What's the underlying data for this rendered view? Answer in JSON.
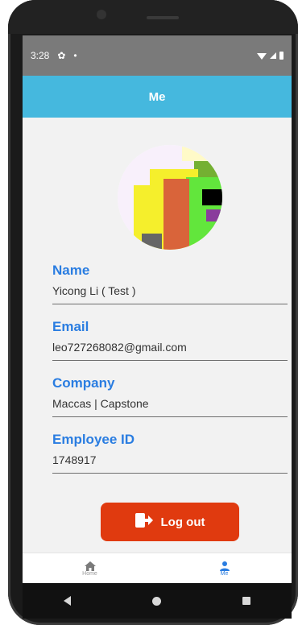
{
  "status_bar": {
    "time": "3:28",
    "gear_icon": "gear-icon",
    "dot": "•"
  },
  "app_bar": {
    "title": "Me"
  },
  "profile": {
    "fields": [
      {
        "label": "Name",
        "value": "Yicong Li ( Test )"
      },
      {
        "label": "Email",
        "value": "leo727268082@gmail.com"
      },
      {
        "label": "Company",
        "value": "Maccas | Capstone"
      },
      {
        "label": "Employee ID",
        "value": "1748917"
      }
    ]
  },
  "logout_button": {
    "label": "Log out",
    "icon": "logout-icon"
  },
  "tabs": [
    {
      "label": "Home",
      "icon": "home-icon",
      "active": false
    },
    {
      "label": "Me",
      "icon": "person-icon",
      "active": true
    }
  ],
  "colors": {
    "app_bar": "#45b8de",
    "accent": "#2a7de1",
    "logout": "#e03a0f"
  }
}
